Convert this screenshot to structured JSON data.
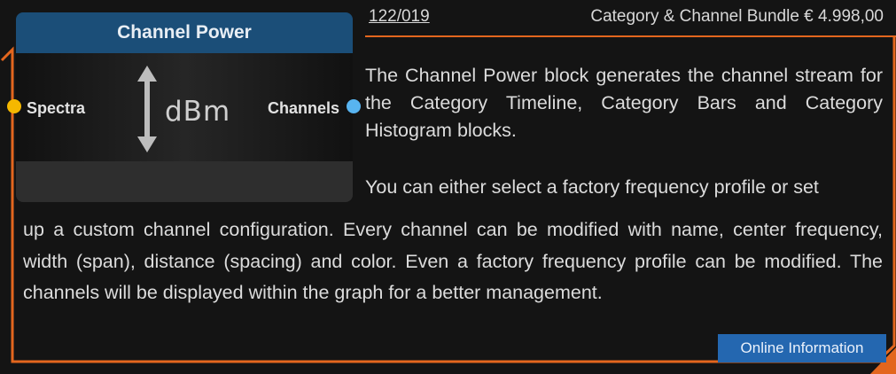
{
  "header": {
    "code": "122/019",
    "title": "Category & Channel Bundle € 4.998,00"
  },
  "block": {
    "title": "Channel Power",
    "unit": "dBm",
    "input_label": "Spectra",
    "output_label": "Channels",
    "input_color": "#f5b800",
    "output_color": "#58b4f0",
    "icon": "vertical-double-arrow-icon"
  },
  "description": {
    "paragraph1": "The Channel Power block generates the channel stream for the Category Timeline, Category Bars and Category Histogram blocks.",
    "paragraph2_start": "You can either select a factory frequency profile or set",
    "paragraph2_rest": "up a custom channel configuration. Every channel can be modified with name, center frequency, width (span), distance (spacing) and color. Even a factory frequency profile can be modified. The channels will be displayed within the graph for a better management."
  },
  "online_button": {
    "label": "Online Information"
  },
  "colors": {
    "accent": "#e3661e",
    "block_header": "#1b4e78",
    "button": "#2467b0"
  }
}
